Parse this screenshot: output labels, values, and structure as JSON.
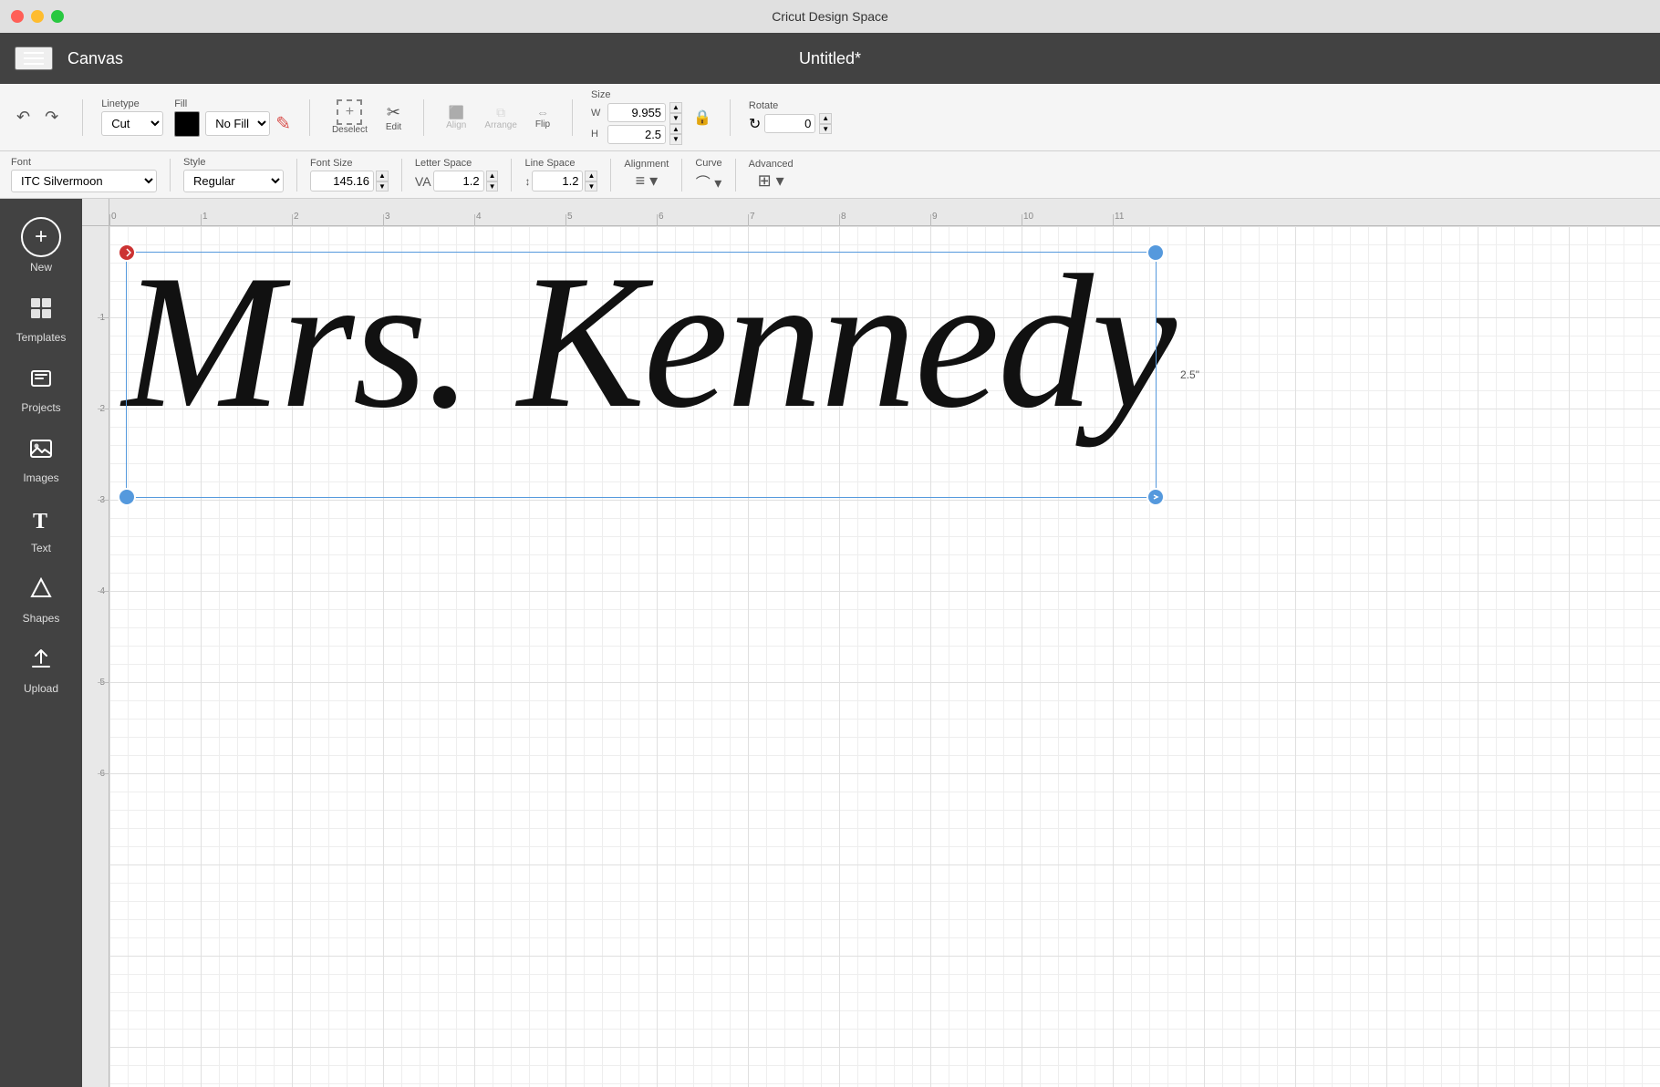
{
  "titlebar": {
    "title": "Cricut Design Space"
  },
  "header": {
    "menu_label": "☰",
    "canvas_label": "Canvas",
    "document_title": "Untitled*"
  },
  "toolbar": {
    "linetype_label": "Linetype",
    "linetype_value": "Cut",
    "fill_label": "Fill",
    "fill_value": "No Fill",
    "deselect_label": "Deselect",
    "edit_label": "Edit",
    "align_label": "Align",
    "arrange_label": "Arrange",
    "flip_label": "Flip",
    "size_label": "Size",
    "width_label": "W",
    "width_value": "9.955",
    "height_label": "H",
    "height_value": "2.5",
    "rotate_label": "Rotate",
    "rotate_value": "0"
  },
  "font_toolbar": {
    "font_label": "Font",
    "font_value": "ITC Silvermoon",
    "style_label": "Style",
    "style_value": "Regular",
    "font_size_label": "Font Size",
    "font_size_value": "145.16",
    "letter_space_label": "Letter Space",
    "letter_space_value": "1.2",
    "line_space_label": "Line Space",
    "line_space_value": "1.2",
    "alignment_label": "Alignment",
    "curve_label": "Curve",
    "advanced_label": "Advanced"
  },
  "sidebar": {
    "items": [
      {
        "id": "new",
        "label": "New",
        "icon": "+"
      },
      {
        "id": "templates",
        "label": "Templates",
        "icon": "▤"
      },
      {
        "id": "projects",
        "label": "Projects",
        "icon": "✦"
      },
      {
        "id": "images",
        "label": "Images",
        "icon": "⬜"
      },
      {
        "id": "text",
        "label": "Text",
        "icon": "T"
      },
      {
        "id": "shapes",
        "label": "Shapes",
        "icon": "✦"
      },
      {
        "id": "upload",
        "label": "Upload",
        "icon": "⬆"
      }
    ]
  },
  "canvas": {
    "text_content": "Mrs. Kennedy",
    "dimension_label": "2.5\"",
    "ruler_marks": [
      "0",
      "1",
      "2",
      "3",
      "4",
      "5",
      "6",
      "7",
      "8",
      "9",
      "10",
      "11"
    ],
    "ruler_marks_v": [
      "1",
      "2",
      "3",
      "4",
      "5",
      "6"
    ]
  }
}
